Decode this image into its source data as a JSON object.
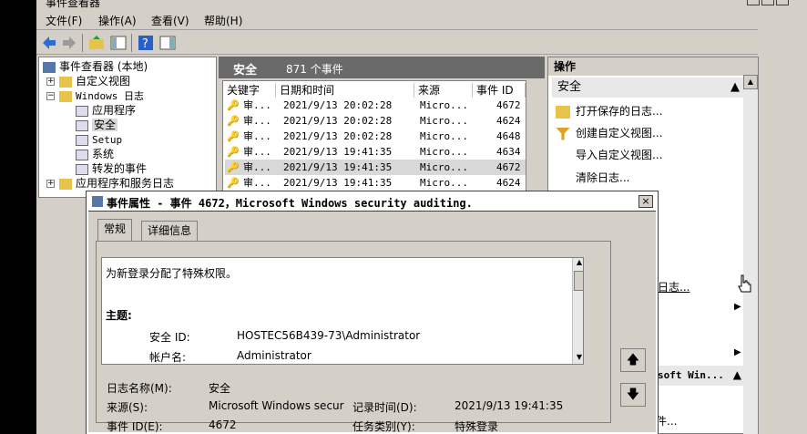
{
  "window": {
    "title": "事件查看器"
  },
  "menu": [
    "文件(F)",
    "操作(A)",
    "查看(V)",
    "帮助(H)"
  ],
  "tree": {
    "root": "事件查看器 (本地)",
    "custom_views": "自定义视图",
    "windows_logs": "Windows 日志",
    "application": "应用程序",
    "security": "安全",
    "setup": "Setup",
    "system": "系统",
    "forwarded": "转发的事件",
    "app_services": "应用程序和服务日志"
  },
  "center": {
    "title": "安全",
    "count": "871 个事件",
    "columns": [
      "关键字",
      "日期和时间",
      "来源",
      "事件 ID"
    ],
    "rows": [
      {
        "keyword": "审...",
        "date": "2021/9/13 20:02:28",
        "source": "Micro...",
        "id": "4672"
      },
      {
        "keyword": "审...",
        "date": "2021/9/13 20:02:28",
        "source": "Micro...",
        "id": "4624"
      },
      {
        "keyword": "审...",
        "date": "2021/9/13 20:02:28",
        "source": "Micro...",
        "id": "4648"
      },
      {
        "keyword": "审...",
        "date": "2021/9/13 19:41:35",
        "source": "Micro...",
        "id": "4634"
      },
      {
        "keyword": "审...",
        "date": "2021/9/13 19:41:35",
        "source": "Micro...",
        "id": "4672"
      },
      {
        "keyword": "审...",
        "date": "2021/9/13 19:41:35",
        "source": "Micro...",
        "id": "4624"
      }
    ]
  },
  "actions": {
    "title": "操作",
    "section": "安全",
    "items": [
      "打开保存的日志...",
      "创建自定义视图...",
      "导入自定义视图...",
      "清除日志..."
    ],
    "partial1": "日志...",
    "partial2": "soft Win..."
  },
  "dialog": {
    "title": "事件属性 - 事件 4672，Microsoft Windows security auditing.",
    "close": "×",
    "tabs": [
      "常规",
      "详细信息"
    ],
    "description": "为新登录分配了特殊权限。",
    "subject_label": "主题:",
    "security_id_label": "安全 ID:",
    "security_id": "HOSTEC56B439-73\\Administrator",
    "account_label": "帐户名:",
    "account": "Administrator",
    "log_name_label": "日志名称(M):",
    "log_name": "安全",
    "source_label": "来源(S):",
    "source": "Microsoft Windows secur",
    "recorded_label": "记录时间(D):",
    "recorded": "2021/9/13 19:41:35",
    "event_id_label": "事件 ID(E):",
    "event_id": "4672",
    "category_label": "任务类别(Y):",
    "category": "特殊登录",
    "partial_bottom": "件..."
  }
}
